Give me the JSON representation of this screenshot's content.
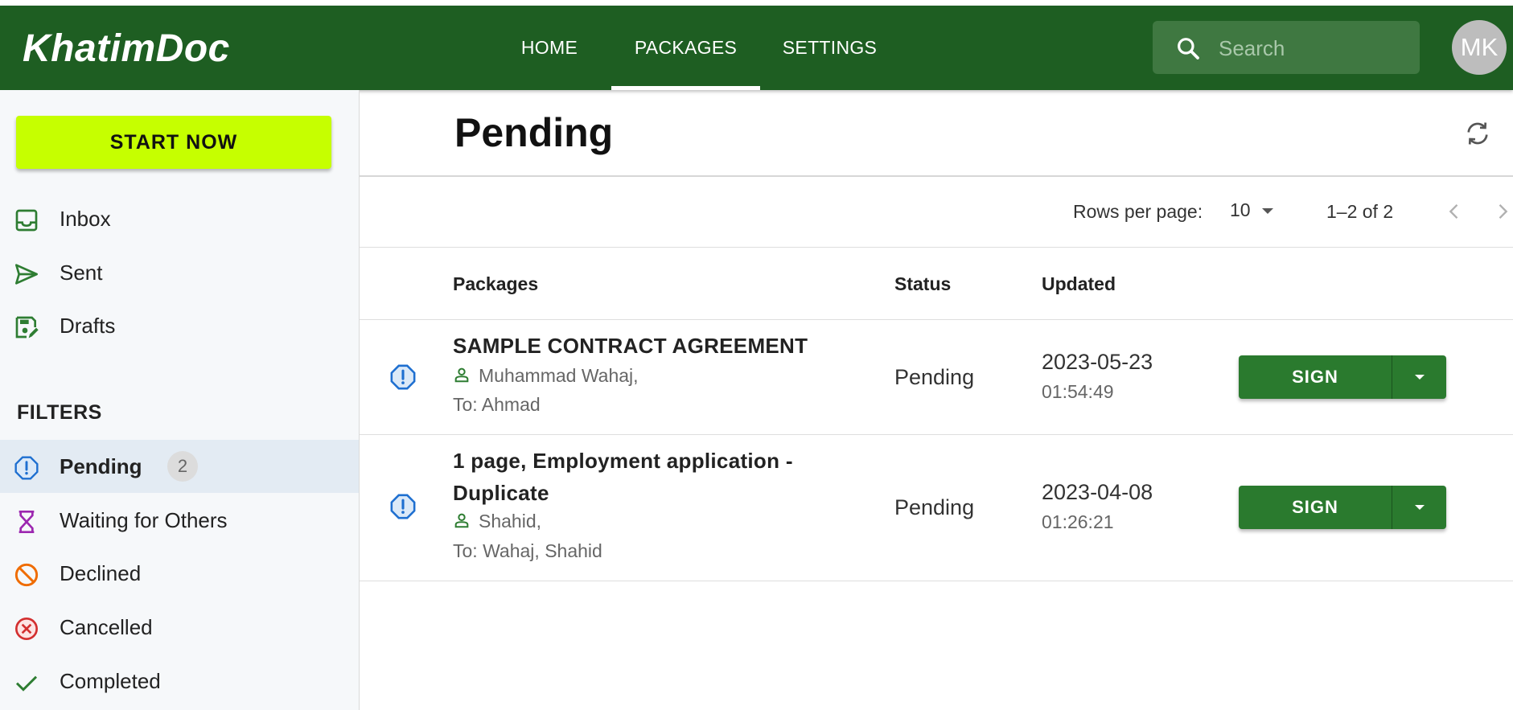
{
  "app": {
    "logo": "KhatimDoc",
    "nav": [
      {
        "label": "HOME"
      },
      {
        "label": "PACKAGES"
      },
      {
        "label": "SETTINGS"
      }
    ],
    "active_nav": "PACKAGES",
    "search_placeholder": "Search",
    "avatar_initials": "MK",
    "brand_color": "#1e5e22"
  },
  "sidebar": {
    "start_button": "START NOW",
    "folders": [
      {
        "label": "Inbox",
        "icon": "inbox-icon"
      },
      {
        "label": "Sent",
        "icon": "send-icon"
      },
      {
        "label": "Drafts",
        "icon": "drafts-icon"
      }
    ],
    "filters_title": "FILTERS",
    "filters": [
      {
        "label": "Pending",
        "icon": "pending-icon",
        "count": "2",
        "selected": true
      },
      {
        "label": "Waiting for Others",
        "icon": "hourglass-icon"
      },
      {
        "label": "Declined",
        "icon": "declined-icon"
      },
      {
        "label": "Cancelled",
        "icon": "cancelled-icon"
      },
      {
        "label": "Completed",
        "icon": "check-icon"
      }
    ]
  },
  "main": {
    "title": "Pending",
    "pagination": {
      "rows_label": "Rows per page:",
      "rows_value": "10",
      "range": "1–2 of 2"
    },
    "columns": [
      "Packages",
      "Status",
      "Updated"
    ],
    "rows": [
      {
        "title": "SAMPLE CONTRACT AGREEMENT",
        "sender": "Muhammad Wahaj,",
        "to": "To: Ahmad",
        "status": "Pending",
        "date": "2023-05-23",
        "time": "01:54:49",
        "action": "SIGN"
      },
      {
        "title": "1 page, Employment application - Duplicate",
        "sender": "Shahid,",
        "to": "To: Wahaj, Shahid",
        "status": "Pending",
        "date": "2023-04-08",
        "time": "01:26:21",
        "action": "SIGN"
      }
    ]
  }
}
